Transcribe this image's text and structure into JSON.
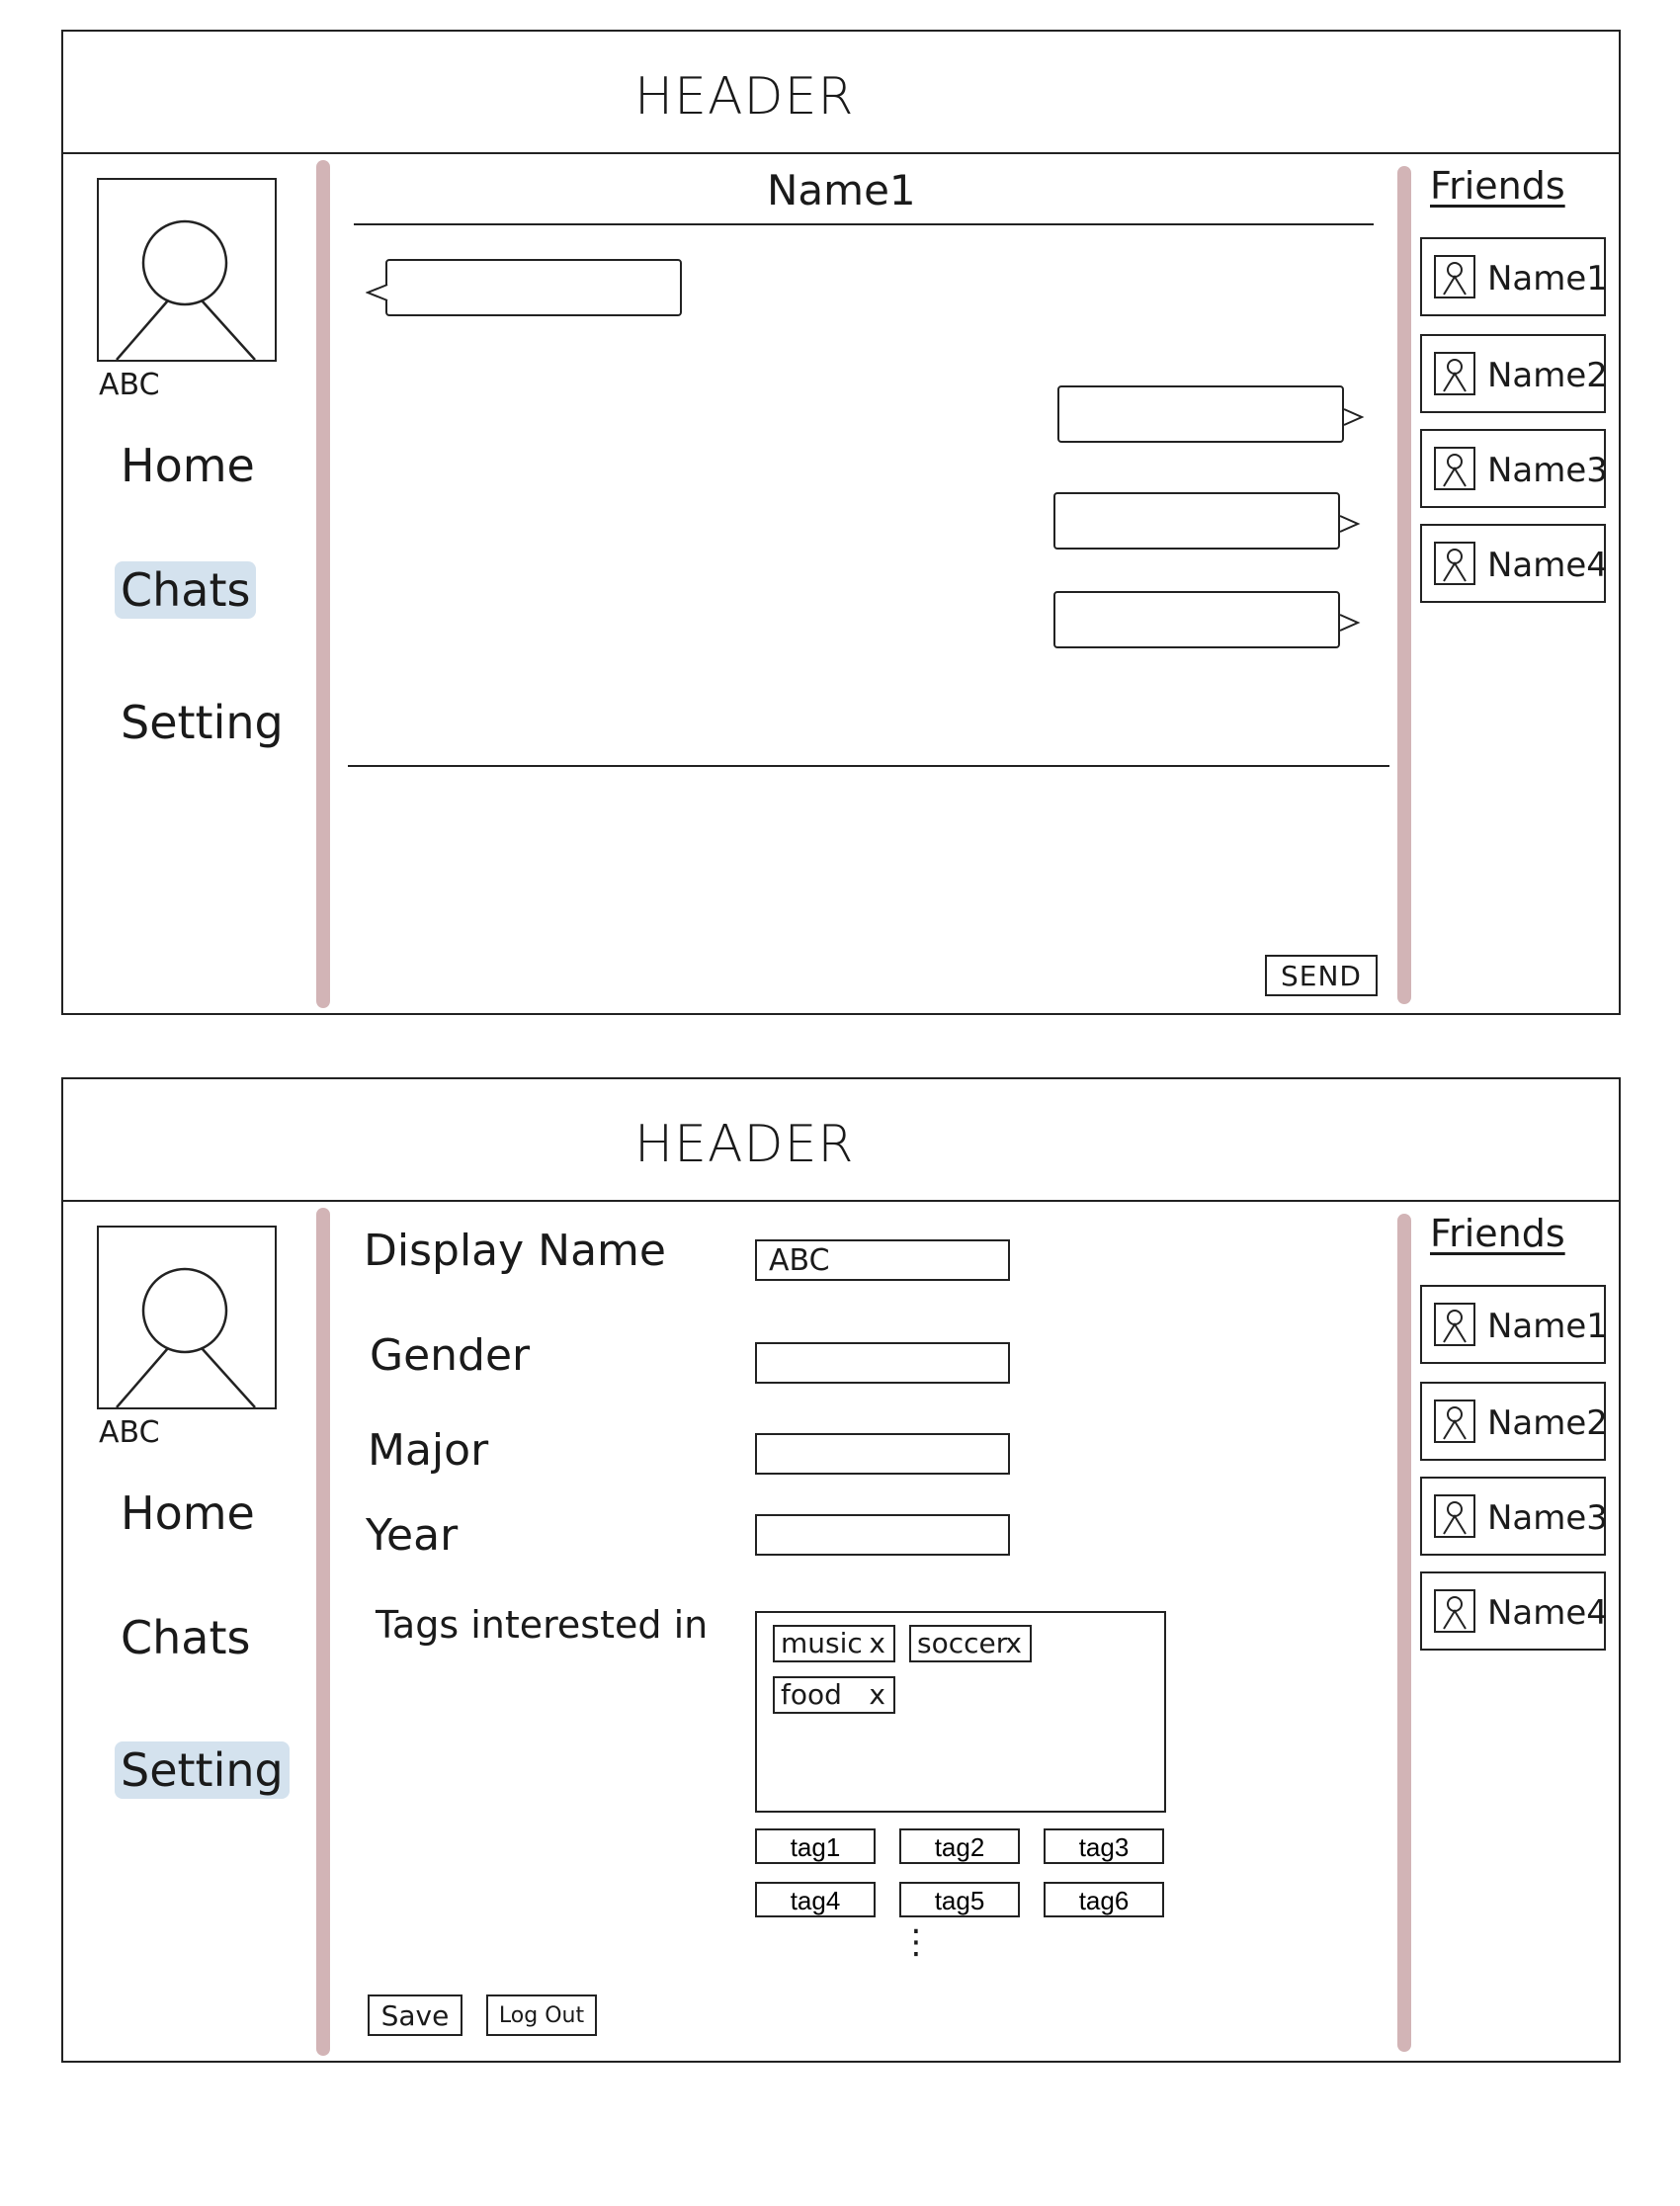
{
  "colors": {
    "active_highlight": "#d4e2ee",
    "divider": "#d2b4b6",
    "stroke": "#222222"
  },
  "header": {
    "title": "HEADER"
  },
  "user": {
    "name": "ABC"
  },
  "nav": {
    "items": [
      "Home",
      "Chats",
      "Setting"
    ]
  },
  "friends": {
    "title": "Friends",
    "items": [
      "Name1",
      "Name2",
      "Name3",
      "Name4"
    ]
  },
  "chat_screen": {
    "active_nav": "Chats",
    "title": "Name1",
    "send_label": "SEND"
  },
  "settings_screen": {
    "active_nav": "Setting",
    "fields": {
      "display_name_label": "Display Name",
      "display_name_value": "ABC",
      "gender_label": "Gender",
      "major_label": "Major",
      "year_label": "Year",
      "tags_label": "Tags interested in"
    },
    "selected_tags": [
      "music",
      "soccer",
      "food"
    ],
    "remove_glyph": "x",
    "tag_options": [
      "tag1",
      "tag2",
      "tag3",
      "tag4",
      "tag5",
      "tag6"
    ],
    "more_indicator": "⋮",
    "save_label": "Save",
    "logout_label": "Log Out"
  }
}
